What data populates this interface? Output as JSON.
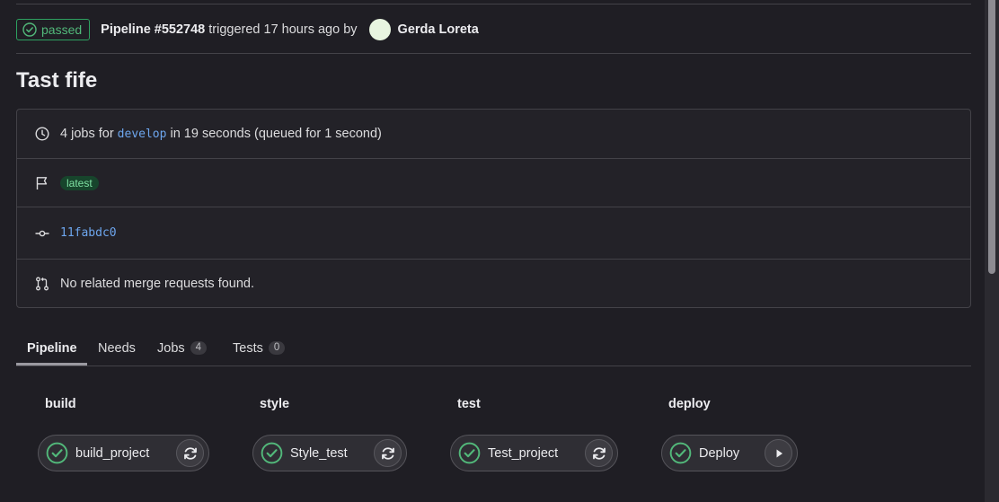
{
  "header": {
    "status_label": "passed",
    "pipeline_label": "Pipeline #552748",
    "triggered_text": " triggered 17 hours ago by ",
    "user_name": "Gerda Loreta"
  },
  "title": "Tast fife",
  "info": {
    "jobs_prefix": "4 jobs for ",
    "branch": "develop",
    "jobs_suffix": " in 19 seconds (queued for 1 second)",
    "tag_latest": "latest",
    "commit_sha": "11fabdc0",
    "merge_requests": "No related merge requests found."
  },
  "tabs": [
    {
      "label": "Pipeline"
    },
    {
      "label": "Needs"
    },
    {
      "label": "Jobs",
      "count": "4"
    },
    {
      "label": "Tests",
      "count": "0"
    }
  ],
  "stages": [
    {
      "title": "build",
      "job": "build_project",
      "action": "retry"
    },
    {
      "title": "style",
      "job": "Style_test",
      "action": "retry"
    },
    {
      "title": "test",
      "job": "Test_project",
      "action": "retry"
    },
    {
      "title": "deploy",
      "job": "Deploy",
      "action": "play"
    }
  ],
  "colors": {
    "success": "#52b87a",
    "link": "#6da6ee",
    "background": "#1f1e24"
  }
}
